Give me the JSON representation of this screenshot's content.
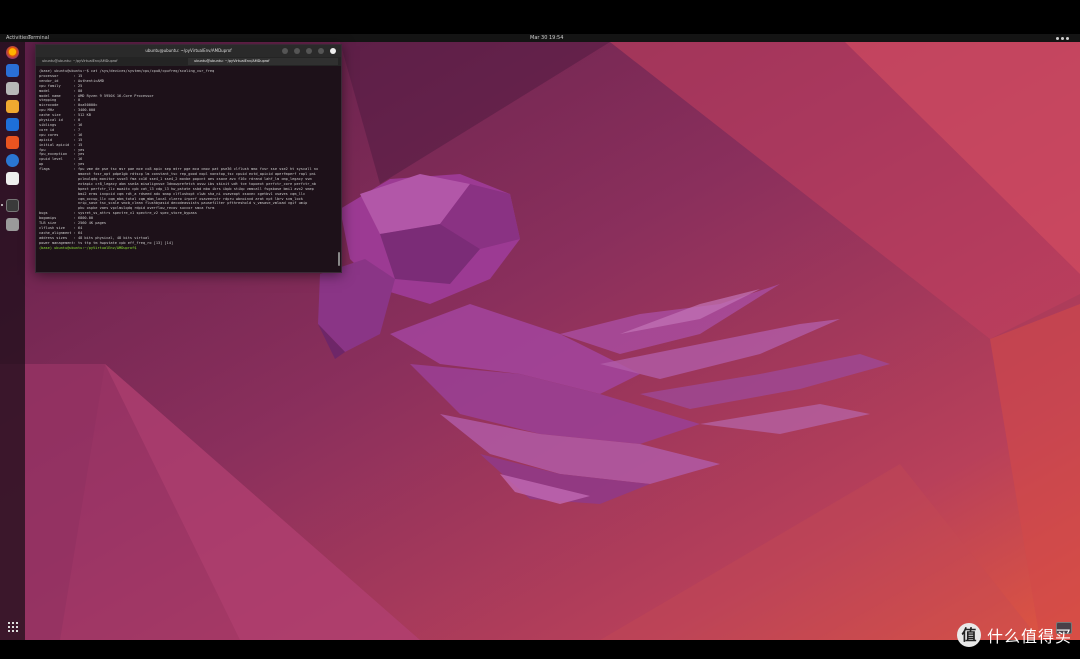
{
  "topbar": {
    "activities": "Activities",
    "app_name": "Terminal",
    "clock": "Mar 30 19:54"
  },
  "dock": {
    "apps": [
      "firefox",
      "thunderbird",
      "files",
      "rhythmbox",
      "libreoffice-writer",
      "software",
      "help",
      "text-editor",
      "terminal",
      "trash"
    ],
    "accent": "#e95420"
  },
  "terminal": {
    "title": "ubuntu@ubuntu: ~/pyVirtualEnv/AMDuprof",
    "tabs": [
      "ubuntu@ubuntu: ~/pyVirtualEnv/AMDuprof",
      "ubuntu@ubuntu: ~/pyVirtualEnv/AMDuprof"
    ],
    "lines": [
      "(base) ubuntu@ubuntu:~$ cat /sys/devices/system/cpu/cpu0/cpufreq/scaling_cur_freq",
      "processor       : 15",
      "vendor_id       : AuthenticAMD",
      "cpu family      : 25",
      "model           : 80",
      "model name      : AMD Ryzen 9 5950X 16-Core Processor",
      "stepping        : 0",
      "microcode       : 0xa50000c",
      "cpu MHz         : 3400.000",
      "cache size      : 512 KB",
      "physical id     : 0",
      "siblings        : 16",
      "core id         : 7",
      "cpu cores       : 16",
      "apicid          : 15",
      "initial apicid  : 15",
      "fpu             : yes",
      "fpu_exception   : yes",
      "cpuid level     : 16",
      "wp              : yes",
      "flags           : fpu vme de pse tsc msr pae mce cx8 apic sep mtrr pge mca cmov pat pse36 clflush mmx fxsr sse sse2 ht syscall nx",
      "                  mmxext fxsr_opt pdpe1gb rdtscp lm constant_tsc rep_good nopl nonstop_tsc cpuid extd_apicid aperfmperf rapl pni",
      "                  pclmulqdq monitor ssse3 fma cx16 sse4_1 sse4_2 movbe popcnt aes xsave avx f16c rdrand lahf_lm cmp_legacy svm",
      "                  extapic cr8_legacy abm sse4a misalignsse 3dnowprefetch osvw ibs skinit wdt tce topoext perfctr_core perfctr_nb",
      "                  bpext perfctr_llc mwaitx cpb cat_l3 cdp_l3 hw_pstate ssbd mba ibrs ibpb stibp vmmcall fsgsbase bmi1 avx2 smep",
      "                  bmi2 erms invpcid cqm rdt_a rdseed adx smap clflushopt clwb sha_ni xsaveopt xsavec xgetbv1 xsaves cqm_llc",
      "                  cqm_occup_llc cqm_mbm_total cqm_mbm_local clzero irperf xsaveerptr rdpru wbnoinvd arat npt lbrv svm_lock",
      "                  nrip_save tsc_scale vmcb_clean flushbyasid decodeassists pausefilter pfthreshold v_vmsave_vmload vgif umip",
      "                  pku ospke vaes vpclmulqdq rdpid overflow_recov succor smca fsrm",
      "bugs            : sysret_ss_attrs spectre_v1 spectre_v2 spec_store_bypass",
      "bogomips        : 6800.00",
      "TLB size        : 2560 4K pages",
      "clflush size    : 64",
      "cache_alignment : 64",
      "address sizes   : 48 bits physical, 48 bits virtual",
      "power management: ts ttp tm hwpstate cpb eff_freq_ro [13] [14]",
      "",
      "(base) ubuntu@ubuntu:~/pyVirtualEnv/AMDuprof$ "
    ]
  },
  "watermark": {
    "badge": "值",
    "text": "什么值得买"
  }
}
